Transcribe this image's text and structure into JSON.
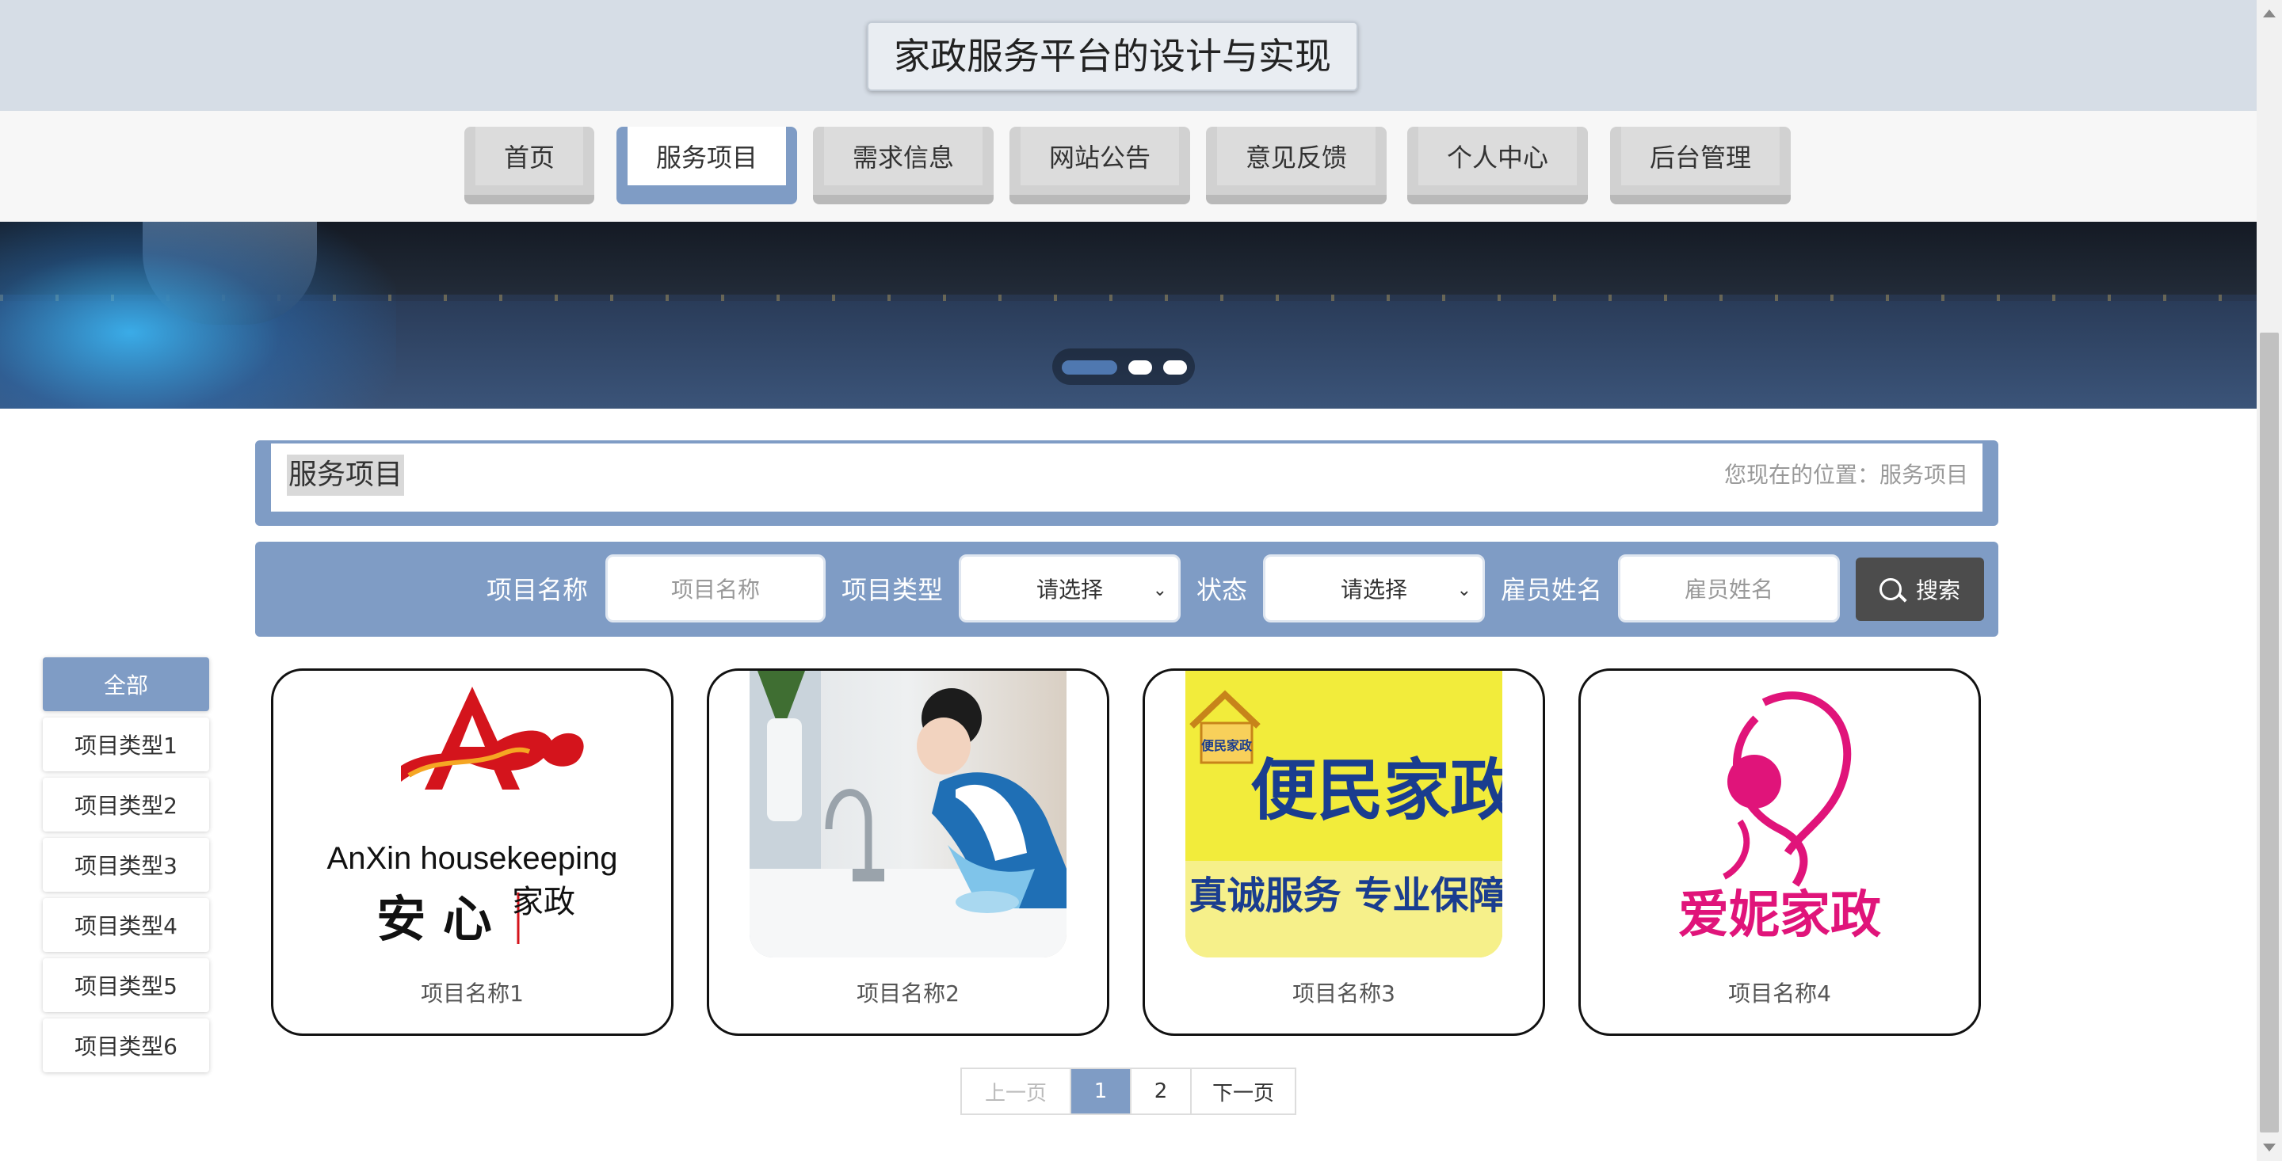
{
  "header": {
    "title": "家政服务平台的设计与实现"
  },
  "nav": [
    {
      "label": "首页",
      "active": false
    },
    {
      "label": "服务项目",
      "active": true
    },
    {
      "label": "需求信息",
      "active": false
    },
    {
      "label": "网站公告",
      "active": false
    },
    {
      "label": "意见反馈",
      "active": false
    },
    {
      "label": "个人中心",
      "active": false
    },
    {
      "label": "后台管理",
      "active": false
    }
  ],
  "banner": {
    "active_slide": 1,
    "slide_count": 3
  },
  "breadcrumb": {
    "title": "服务项目",
    "location": "您现在的位置：服务项目"
  },
  "search": {
    "name_label": "项目名称",
    "name_placeholder": "项目名称",
    "type_label": "项目类型",
    "type_value": "请选择",
    "status_label": "状态",
    "status_value": "请选择",
    "employee_label": "雇员姓名",
    "employee_placeholder": "雇员姓名",
    "button_label": "搜索"
  },
  "categories": [
    "全部",
    "项目类型1",
    "项目类型2",
    "项目类型3",
    "项目类型4",
    "项目类型5",
    "项目类型6"
  ],
  "cards": [
    {
      "name": "项目名称1",
      "logo_text_en": "AnXin housekeeping",
      "logo_text_cn": "安 心",
      "logo_text_side": "家政"
    },
    {
      "name": "项目名称2"
    },
    {
      "name": "项目名称3",
      "logo_text_main": "便民家政",
      "logo_text_sub": "真诚服务  专业保障",
      "logo_badge": "便民家政"
    },
    {
      "name": "项目名称4",
      "logo_text": "爱妮家政"
    }
  ],
  "pagination": {
    "prev": "上一页",
    "pages": [
      "1",
      "2"
    ],
    "current": "1",
    "next": "下一页"
  },
  "colors": {
    "accent": "#7f9cc5",
    "header_bg": "#d6dde6",
    "search_button": "#4c4c4c"
  }
}
